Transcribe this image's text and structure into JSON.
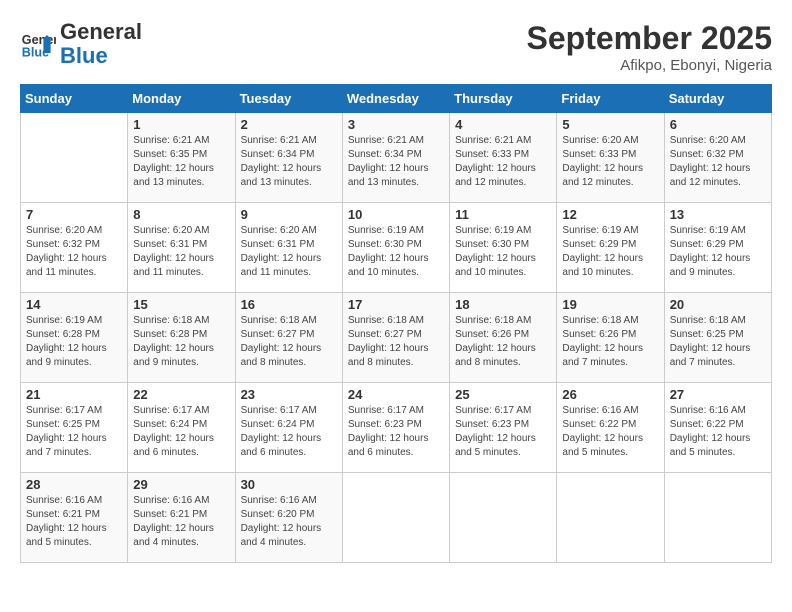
{
  "header": {
    "logo_line1": "General",
    "logo_line2": "Blue",
    "month": "September 2025",
    "location": "Afikpo, Ebonyi, Nigeria"
  },
  "days_of_week": [
    "Sunday",
    "Monday",
    "Tuesday",
    "Wednesday",
    "Thursday",
    "Friday",
    "Saturday"
  ],
  "weeks": [
    [
      {
        "day": "",
        "info": ""
      },
      {
        "day": "1",
        "info": "Sunrise: 6:21 AM\nSunset: 6:35 PM\nDaylight: 12 hours\nand 13 minutes."
      },
      {
        "day": "2",
        "info": "Sunrise: 6:21 AM\nSunset: 6:34 PM\nDaylight: 12 hours\nand 13 minutes."
      },
      {
        "day": "3",
        "info": "Sunrise: 6:21 AM\nSunset: 6:34 PM\nDaylight: 12 hours\nand 13 minutes."
      },
      {
        "day": "4",
        "info": "Sunrise: 6:21 AM\nSunset: 6:33 PM\nDaylight: 12 hours\nand 12 minutes."
      },
      {
        "day": "5",
        "info": "Sunrise: 6:20 AM\nSunset: 6:33 PM\nDaylight: 12 hours\nand 12 minutes."
      },
      {
        "day": "6",
        "info": "Sunrise: 6:20 AM\nSunset: 6:32 PM\nDaylight: 12 hours\nand 12 minutes."
      }
    ],
    [
      {
        "day": "7",
        "info": "Sunrise: 6:20 AM\nSunset: 6:32 PM\nDaylight: 12 hours\nand 11 minutes."
      },
      {
        "day": "8",
        "info": "Sunrise: 6:20 AM\nSunset: 6:31 PM\nDaylight: 12 hours\nand 11 minutes."
      },
      {
        "day": "9",
        "info": "Sunrise: 6:20 AM\nSunset: 6:31 PM\nDaylight: 12 hours\nand 11 minutes."
      },
      {
        "day": "10",
        "info": "Sunrise: 6:19 AM\nSunset: 6:30 PM\nDaylight: 12 hours\nand 10 minutes."
      },
      {
        "day": "11",
        "info": "Sunrise: 6:19 AM\nSunset: 6:30 PM\nDaylight: 12 hours\nand 10 minutes."
      },
      {
        "day": "12",
        "info": "Sunrise: 6:19 AM\nSunset: 6:29 PM\nDaylight: 12 hours\nand 10 minutes."
      },
      {
        "day": "13",
        "info": "Sunrise: 6:19 AM\nSunset: 6:29 PM\nDaylight: 12 hours\nand 9 minutes."
      }
    ],
    [
      {
        "day": "14",
        "info": "Sunrise: 6:19 AM\nSunset: 6:28 PM\nDaylight: 12 hours\nand 9 minutes."
      },
      {
        "day": "15",
        "info": "Sunrise: 6:18 AM\nSunset: 6:28 PM\nDaylight: 12 hours\nand 9 minutes."
      },
      {
        "day": "16",
        "info": "Sunrise: 6:18 AM\nSunset: 6:27 PM\nDaylight: 12 hours\nand 8 minutes."
      },
      {
        "day": "17",
        "info": "Sunrise: 6:18 AM\nSunset: 6:27 PM\nDaylight: 12 hours\nand 8 minutes."
      },
      {
        "day": "18",
        "info": "Sunrise: 6:18 AM\nSunset: 6:26 PM\nDaylight: 12 hours\nand 8 minutes."
      },
      {
        "day": "19",
        "info": "Sunrise: 6:18 AM\nSunset: 6:26 PM\nDaylight: 12 hours\nand 7 minutes."
      },
      {
        "day": "20",
        "info": "Sunrise: 6:18 AM\nSunset: 6:25 PM\nDaylight: 12 hours\nand 7 minutes."
      }
    ],
    [
      {
        "day": "21",
        "info": "Sunrise: 6:17 AM\nSunset: 6:25 PM\nDaylight: 12 hours\nand 7 minutes."
      },
      {
        "day": "22",
        "info": "Sunrise: 6:17 AM\nSunset: 6:24 PM\nDaylight: 12 hours\nand 6 minutes."
      },
      {
        "day": "23",
        "info": "Sunrise: 6:17 AM\nSunset: 6:24 PM\nDaylight: 12 hours\nand 6 minutes."
      },
      {
        "day": "24",
        "info": "Sunrise: 6:17 AM\nSunset: 6:23 PM\nDaylight: 12 hours\nand 6 minutes."
      },
      {
        "day": "25",
        "info": "Sunrise: 6:17 AM\nSunset: 6:23 PM\nDaylight: 12 hours\nand 5 minutes."
      },
      {
        "day": "26",
        "info": "Sunrise: 6:16 AM\nSunset: 6:22 PM\nDaylight: 12 hours\nand 5 minutes."
      },
      {
        "day": "27",
        "info": "Sunrise: 6:16 AM\nSunset: 6:22 PM\nDaylight: 12 hours\nand 5 minutes."
      }
    ],
    [
      {
        "day": "28",
        "info": "Sunrise: 6:16 AM\nSunset: 6:21 PM\nDaylight: 12 hours\nand 5 minutes."
      },
      {
        "day": "29",
        "info": "Sunrise: 6:16 AM\nSunset: 6:21 PM\nDaylight: 12 hours\nand 4 minutes."
      },
      {
        "day": "30",
        "info": "Sunrise: 6:16 AM\nSunset: 6:20 PM\nDaylight: 12 hours\nand 4 minutes."
      },
      {
        "day": "",
        "info": ""
      },
      {
        "day": "",
        "info": ""
      },
      {
        "day": "",
        "info": ""
      },
      {
        "day": "",
        "info": ""
      }
    ]
  ]
}
